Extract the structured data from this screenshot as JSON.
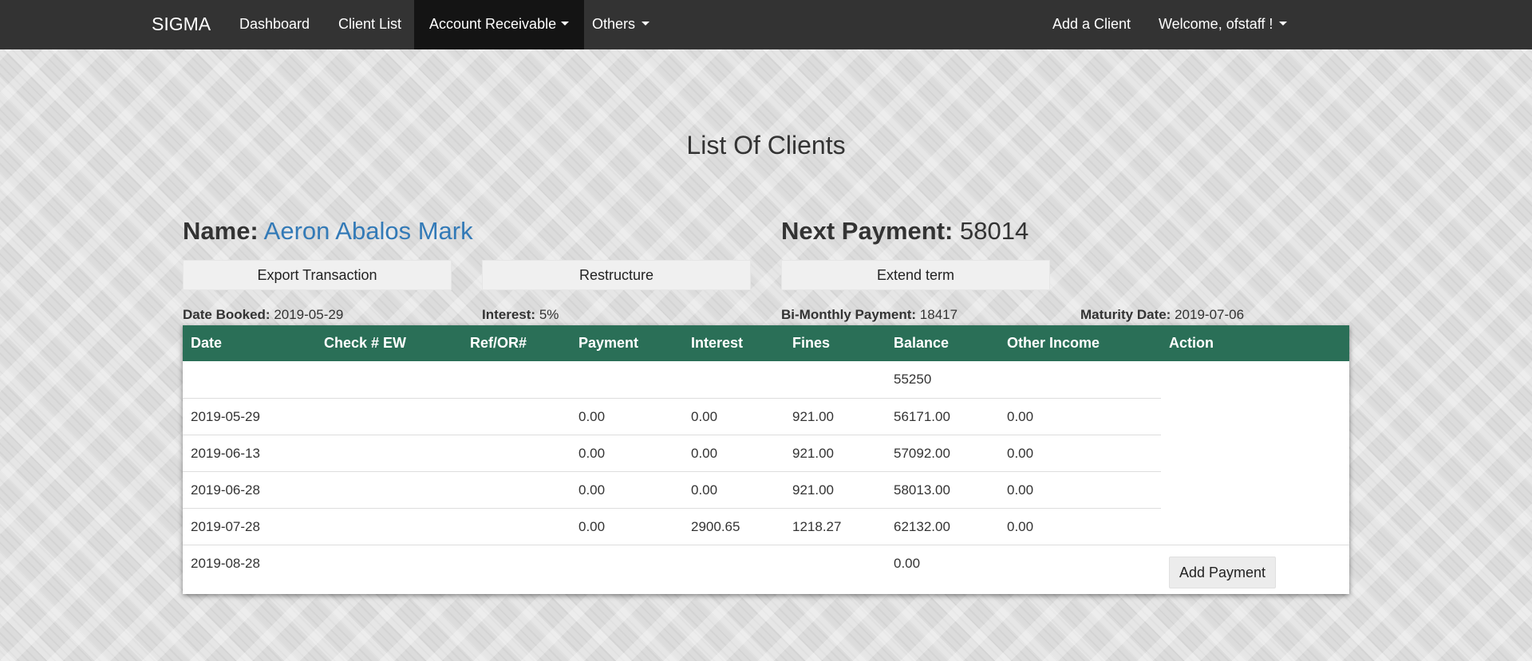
{
  "navbar": {
    "brand": "SIGMA",
    "items": [
      {
        "label": "Dashboard"
      },
      {
        "label": "Client List"
      },
      {
        "label": "Account Receivable"
      },
      {
        "label": "Others"
      }
    ],
    "add_client": "Add a Client",
    "welcome": "Welcome, ofstaff !"
  },
  "page": {
    "title": "List Of Clients"
  },
  "client": {
    "name_label": "Name:",
    "name": "Aeron Abalos Mark",
    "next_payment_label": "Next Payment:",
    "next_payment": "58014"
  },
  "actions": {
    "export": "Export Transaction",
    "restructure": "Restructure",
    "extend": "Extend term"
  },
  "meta": {
    "date_booked_label": "Date Booked:",
    "date_booked": "2019-05-29",
    "interest_label": "Interest:",
    "interest": "5%",
    "bimonthly_label": "Bi-Monthly Payment:",
    "bimonthly": "18417",
    "maturity_label": "Maturity Date:",
    "maturity": "2019-07-06"
  },
  "table": {
    "headers": [
      "Date",
      "Check # EW",
      "Ref/OR#",
      "Payment",
      "Interest",
      "Fines",
      "Balance",
      "Other Income",
      "Action"
    ],
    "rows": [
      {
        "date": "",
        "check": "",
        "ref": "",
        "payment": "",
        "interest": "",
        "fines": "",
        "balance": "55250",
        "other": ""
      },
      {
        "date": "2019-05-29",
        "check": "",
        "ref": "",
        "payment": "0.00",
        "interest": "0.00",
        "fines": "921.00",
        "balance": "56171.00",
        "other": "0.00"
      },
      {
        "date": "2019-06-13",
        "check": "",
        "ref": "",
        "payment": "0.00",
        "interest": "0.00",
        "fines": "921.00",
        "balance": "57092.00",
        "other": "0.00"
      },
      {
        "date": "2019-06-28",
        "check": "",
        "ref": "",
        "payment": "0.00",
        "interest": "0.00",
        "fines": "921.00",
        "balance": "58013.00",
        "other": "0.00"
      },
      {
        "date": "2019-07-28",
        "check": "",
        "ref": "",
        "payment": "0.00",
        "interest": "2900.65",
        "fines": "1218.27",
        "balance": "62132.00",
        "other": "0.00"
      },
      {
        "date": "2019-08-28",
        "check": "",
        "ref": "",
        "payment": "",
        "interest": "",
        "fines": "",
        "balance": "0.00",
        "other": ""
      }
    ],
    "add_payment": "Add Payment"
  },
  "colors": {
    "navbar": "#333333",
    "nav_active": "#141414",
    "table_header": "#2a6f57",
    "link": "#337ab7"
  }
}
